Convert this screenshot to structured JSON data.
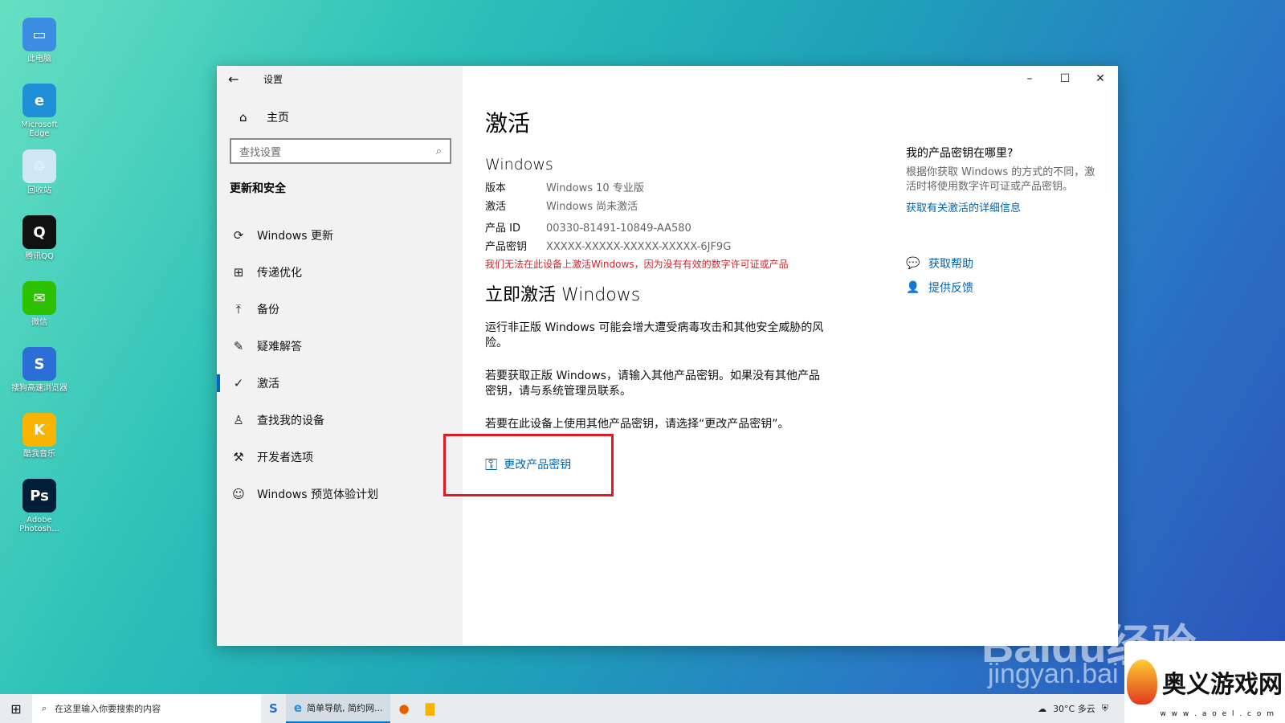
{
  "desktop": {
    "icons": [
      {
        "label": "此电脑",
        "color": "#3a8de0",
        "glyph": "▭"
      },
      {
        "label": "Microsoft Edge",
        "color": "#1f8fd8",
        "glyph": "e"
      },
      {
        "label": "回收站",
        "color": "#cfe6f4",
        "glyph": "♲"
      },
      {
        "label": "腾讯QQ",
        "color": "#111111",
        "glyph": "Q"
      },
      {
        "label": "微信",
        "color": "#2dc100",
        "glyph": "✉"
      },
      {
        "label": "搜狗高速浏览器",
        "color": "#2b6fd6",
        "glyph": "S"
      },
      {
        "label": "酷我音乐",
        "color": "#f8b400",
        "glyph": "K"
      },
      {
        "label": "Adobe Photosh...",
        "color": "#001e36",
        "glyph": "Ps"
      }
    ]
  },
  "window": {
    "title": "设置",
    "back_glyph": "←",
    "controls": {
      "minimize": "–",
      "maximize": "☐",
      "close": "✕"
    }
  },
  "sidebar": {
    "home_label": "主页",
    "search_placeholder": "查找设置",
    "section_title": "更新和安全",
    "items": [
      {
        "label": "Windows 更新",
        "icon": "refresh-icon",
        "glyph": "⟳"
      },
      {
        "label": "传递优化",
        "icon": "delivery-icon",
        "glyph": "⊞"
      },
      {
        "label": "备份",
        "icon": "backup-icon",
        "glyph": "⤒"
      },
      {
        "label": "疑难解答",
        "icon": "wrench-icon",
        "glyph": "✎"
      },
      {
        "label": "激活",
        "icon": "check-circle-icon",
        "glyph": "✓"
      },
      {
        "label": "查找我的设备",
        "icon": "person-icon",
        "glyph": "♙"
      },
      {
        "label": "开发者选项",
        "icon": "tools-icon",
        "glyph": "⚒"
      },
      {
        "label": "Windows 预览体验计划",
        "icon": "insider-icon",
        "glyph": "☺"
      }
    ]
  },
  "main": {
    "page_title": "激活",
    "windows_heading": "Windows",
    "edition_key": "版本",
    "edition_value": "Windows 10 专业版",
    "activation_key": "激活",
    "activation_value": "Windows 尚未激活",
    "product_id_key": "产品 ID",
    "product_id_value": "00330-81491-10849-AA580",
    "product_key_key": "产品密钥",
    "product_key_value": "XXXXX-XXXXX-XXXXX-XXXXX-6JF9G",
    "error": "我们无法在此设备上激活Windows，因为没有有效的数字许可证或产品",
    "activate_heading": "立即激活 Windows",
    "para1": "运行非正版 Windows 可能会增大遭受病毒攻击和其他安全威胁的风险。",
    "para2": "若要获取正版 Windows，请输入其他产品密钥。如果没有其他产品密钥，请与系统管理员联系。",
    "para3": "若要在此设备上使用其他产品密钥，请选择“更改产品密钥”。",
    "change_key_label": "更改产品密钥"
  },
  "right_panel": {
    "heading": "我的产品密钥在哪里?",
    "text": "根据你获取 Windows 的方式的不同，激活时将使用数字许可证或产品密钥。",
    "link": "获取有关激活的详细信息",
    "help_label": "获取帮助",
    "feedback_label": "提供反馈"
  },
  "taskbar": {
    "search_placeholder": "在这里输入你要搜索的内容",
    "app_browser": "简单导航, 简约网...",
    "weather": "30°C 多云"
  },
  "watermark": {
    "baidu": "Baidu经验",
    "jingyan": "jingyan.bai",
    "logo_text": "奥义游戏网",
    "logo_url": "w w w . a o e l . c o m"
  }
}
